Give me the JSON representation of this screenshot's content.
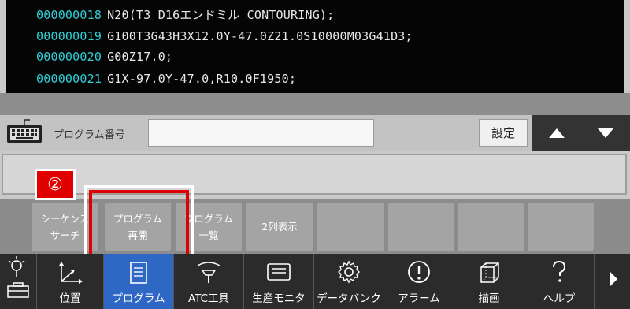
{
  "code": {
    "lines": [
      {
        "num": "000000018",
        "text": "N20(T3 D16エンドミル CONTOURING);"
      },
      {
        "num": "000000019",
        "text": "G100T3G43H3X12.0Y-47.0Z21.0S10000M03G41D3;"
      },
      {
        "num": "000000020",
        "text": "G00Z17.0;"
      },
      {
        "num": "000000021",
        "text": "G1X-97.0Y-47.0,R10.0F1950;"
      }
    ]
  },
  "input": {
    "label": "プログラム番号",
    "value": "",
    "set_label": "設定"
  },
  "badge": "②",
  "softkeys": [
    {
      "line1": "シーケンス",
      "line2": "サーチ"
    },
    {
      "line1": "プログラム",
      "line2": "再開"
    },
    {
      "line1": "プログラム",
      "line2": "一覧"
    },
    {
      "line1": "2列表示",
      "line2": ""
    }
  ],
  "nav": {
    "items": [
      {
        "label": "位置",
        "icon": "axes-icon"
      },
      {
        "label": "プログラム",
        "icon": "program-icon"
      },
      {
        "label": "ATC工具",
        "icon": "atc-tool-icon"
      },
      {
        "label": "生産モニタ",
        "icon": "monitor-icon"
      },
      {
        "label": "データバンク",
        "icon": "gear-icon"
      },
      {
        "label": "アラーム",
        "icon": "alarm-icon"
      },
      {
        "label": "描画",
        "icon": "cube-icon"
      },
      {
        "label": "ヘルプ",
        "icon": "help-icon"
      }
    ]
  },
  "colors": {
    "linenum": "#2fd0d8",
    "active": "#2f67c4",
    "highlight": "#e00000"
  }
}
